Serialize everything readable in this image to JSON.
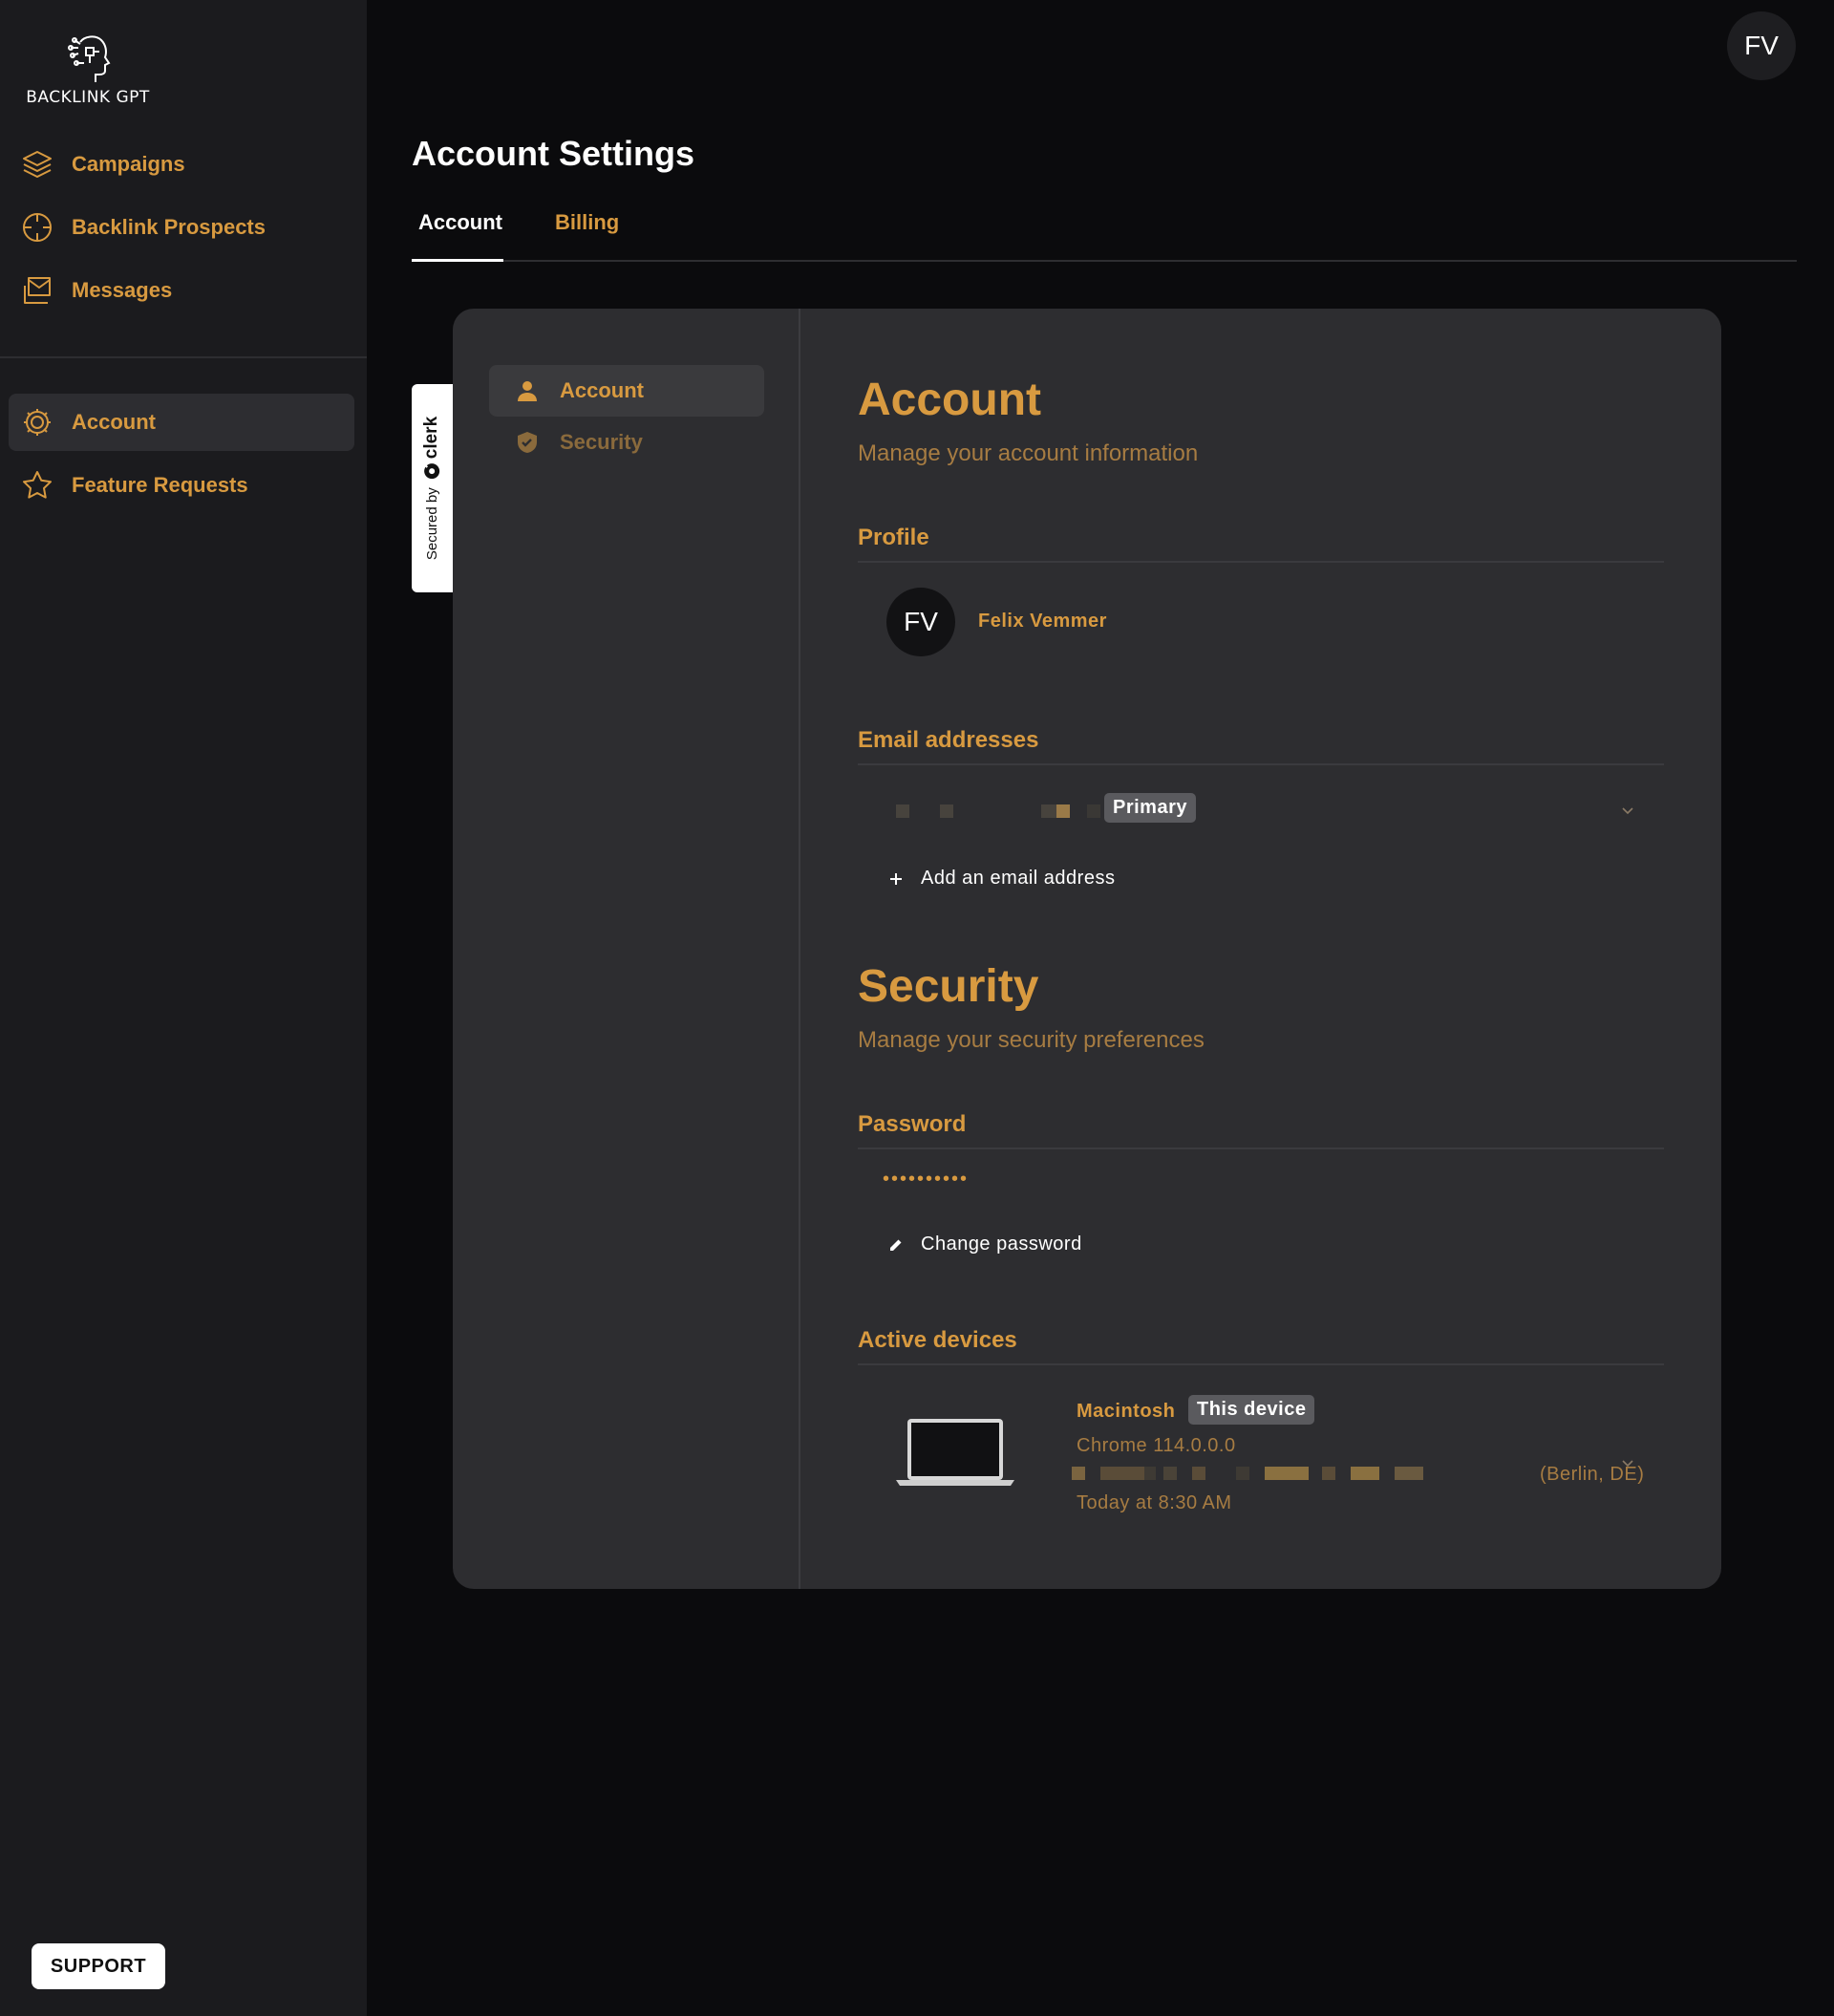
{
  "app": {
    "logo_text": "BACKLINK GPT",
    "accent_color": "#d89a40"
  },
  "sidebar": {
    "nav_top": [
      {
        "label": "Campaigns",
        "icon": "layers-icon"
      },
      {
        "label": "Backlink Prospects",
        "icon": "crosshair-icon"
      },
      {
        "label": "Messages",
        "icon": "mail-icon"
      }
    ],
    "nav_bottom": [
      {
        "label": "Account",
        "icon": "gear-icon",
        "active": true
      },
      {
        "label": "Feature Requests",
        "icon": "star-icon"
      }
    ],
    "support_label": "SUPPORT"
  },
  "header": {
    "user_initials": "FV",
    "page_title": "Account Settings",
    "tabs": [
      {
        "label": "Account",
        "active": true
      },
      {
        "label": "Billing",
        "active": false
      }
    ]
  },
  "clerk_badge": {
    "secured_by": "Secured by",
    "brand": "clerk"
  },
  "card": {
    "nav": [
      {
        "label": "Account",
        "icon": "user-icon",
        "active": true
      },
      {
        "label": "Security",
        "icon": "shield-icon",
        "active": false
      }
    ],
    "account": {
      "title": "Account",
      "subtitle": "Manage your account information",
      "profile_heading": "Profile",
      "profile_initials": "FV",
      "profile_name": "Felix Vemmer",
      "email_heading": "Email addresses",
      "email_badge": "Primary",
      "add_email_label": "Add an email address"
    },
    "security": {
      "title": "Security",
      "subtitle": "Manage your security preferences",
      "password_heading": "Password",
      "password_mask": "••••••••••",
      "change_password_label": "Change password",
      "devices_heading": "Active devices",
      "device": {
        "name": "Macintosh",
        "badge": "This device",
        "browser": "Chrome 114.0.0.0",
        "location": "(Berlin, DE)",
        "last_active": "Today at 8:30 AM"
      }
    }
  }
}
